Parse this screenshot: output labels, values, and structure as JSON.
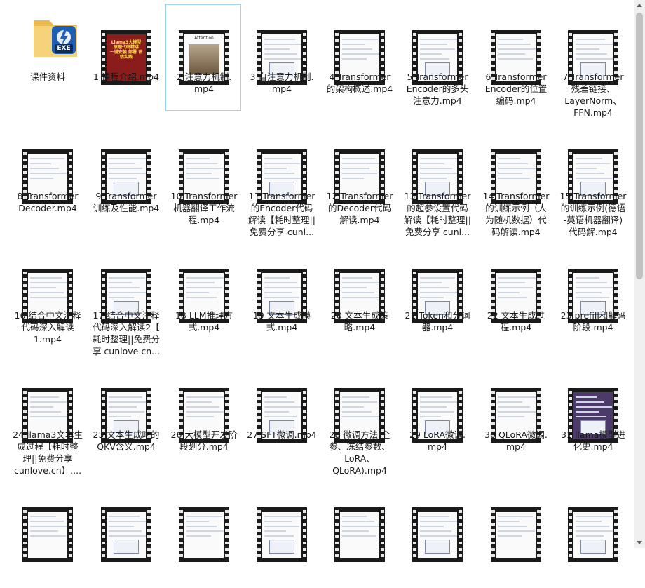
{
  "folder": {
    "label": "课件资料",
    "icon": "exe-folder-icon",
    "badge": "EXE"
  },
  "selected_index": 1,
  "thumbnails": [
    {
      "title": "Llama3大模型\n原理代码精讲\n一键安装 部署 评估实践"
    },
    {
      "title": "Attention"
    },
    {
      "title": ""
    },
    {
      "title": ""
    },
    {
      "title": ""
    },
    {
      "title": ""
    },
    {
      "title": ""
    }
  ],
  "files": [
    {
      "label": "1 课程介绍.mp4"
    },
    {
      "label": "2 注意力机制.\nmp4"
    },
    {
      "label": "3 自注意力机制.\nmp4"
    },
    {
      "label": "4 Transformer\n的架构概述.mp4"
    },
    {
      "label": "5 Transformer\nEncoder的多头\n注意力.mp4"
    },
    {
      "label": "6 Transformer\nEncoder的位置\n编码.mp4"
    },
    {
      "label": "7 Transformer\n残差链接、\nLayerNorm、\nFFN.mp4"
    },
    {
      "label": "8 Transformer\nDecoder.mp4"
    },
    {
      "label": "9 Transformer\n训练及性能.mp4"
    },
    {
      "label": "10 Transformer\n机器翻译工作流\n程.mp4"
    },
    {
      "label": "11 Transformer\n的Encoder代码\n解读【耗时整理||\n免费分享 cunl..."
    },
    {
      "label": "12 Transformer\n的Decoder代码\n解读.mp4"
    },
    {
      "label": "13 Transformer\n的超参设置代码\n解读【耗时整理||\n免费分享 cunl..."
    },
    {
      "label": "14 Transformer\n的训练示例（人\n为随机数据）代\n码解读.mp4"
    },
    {
      "label": "15 Transformer\n的训练示例(德语\n-英语机器翻译)\n代码解.mp4"
    },
    {
      "label": "16 结合中文注释\n代码深入解读\n1.mp4"
    },
    {
      "label": "17 结合中文注释\n代码深入解读2【\n耗时整理||免费分\n享 cunlove.cn..."
    },
    {
      "label": "18 LLM推理方\n式.mp4"
    },
    {
      "label": "19 文本生成模\n式.mp4"
    },
    {
      "label": "20 文本生成策\n略.mp4"
    },
    {
      "label": "21 Token和分词\n器.mp4"
    },
    {
      "label": "22 文本生成过\n程.mp4"
    },
    {
      "label": "23 prefill和解码\n阶段.mp4"
    },
    {
      "label": "24 llama3文本生\n成过程【耗时整\n理||免费分享\ncunlove.cn】...."
    },
    {
      "label": "25 文本生成时的\nQKV含义.mp4"
    },
    {
      "label": "26 大模型开发阶\n段划分.mp4"
    },
    {
      "label": "27 SFT微调.mp4"
    },
    {
      "label": "28 微调方法(全\n参、冻结参数、\nLoRA、\nQLoRA).mp4"
    },
    {
      "label": "29 LoRA微调.\nmp4"
    },
    {
      "label": "30 QLoRA微调.\nmp4"
    },
    {
      "label": "31 llama模型进\n化史.mp4"
    },
    {
      "label": ""
    },
    {
      "label": ""
    },
    {
      "label": ""
    },
    {
      "label": ""
    },
    {
      "label": ""
    },
    {
      "label": ""
    },
    {
      "label": ""
    },
    {
      "label": ""
    }
  ]
}
